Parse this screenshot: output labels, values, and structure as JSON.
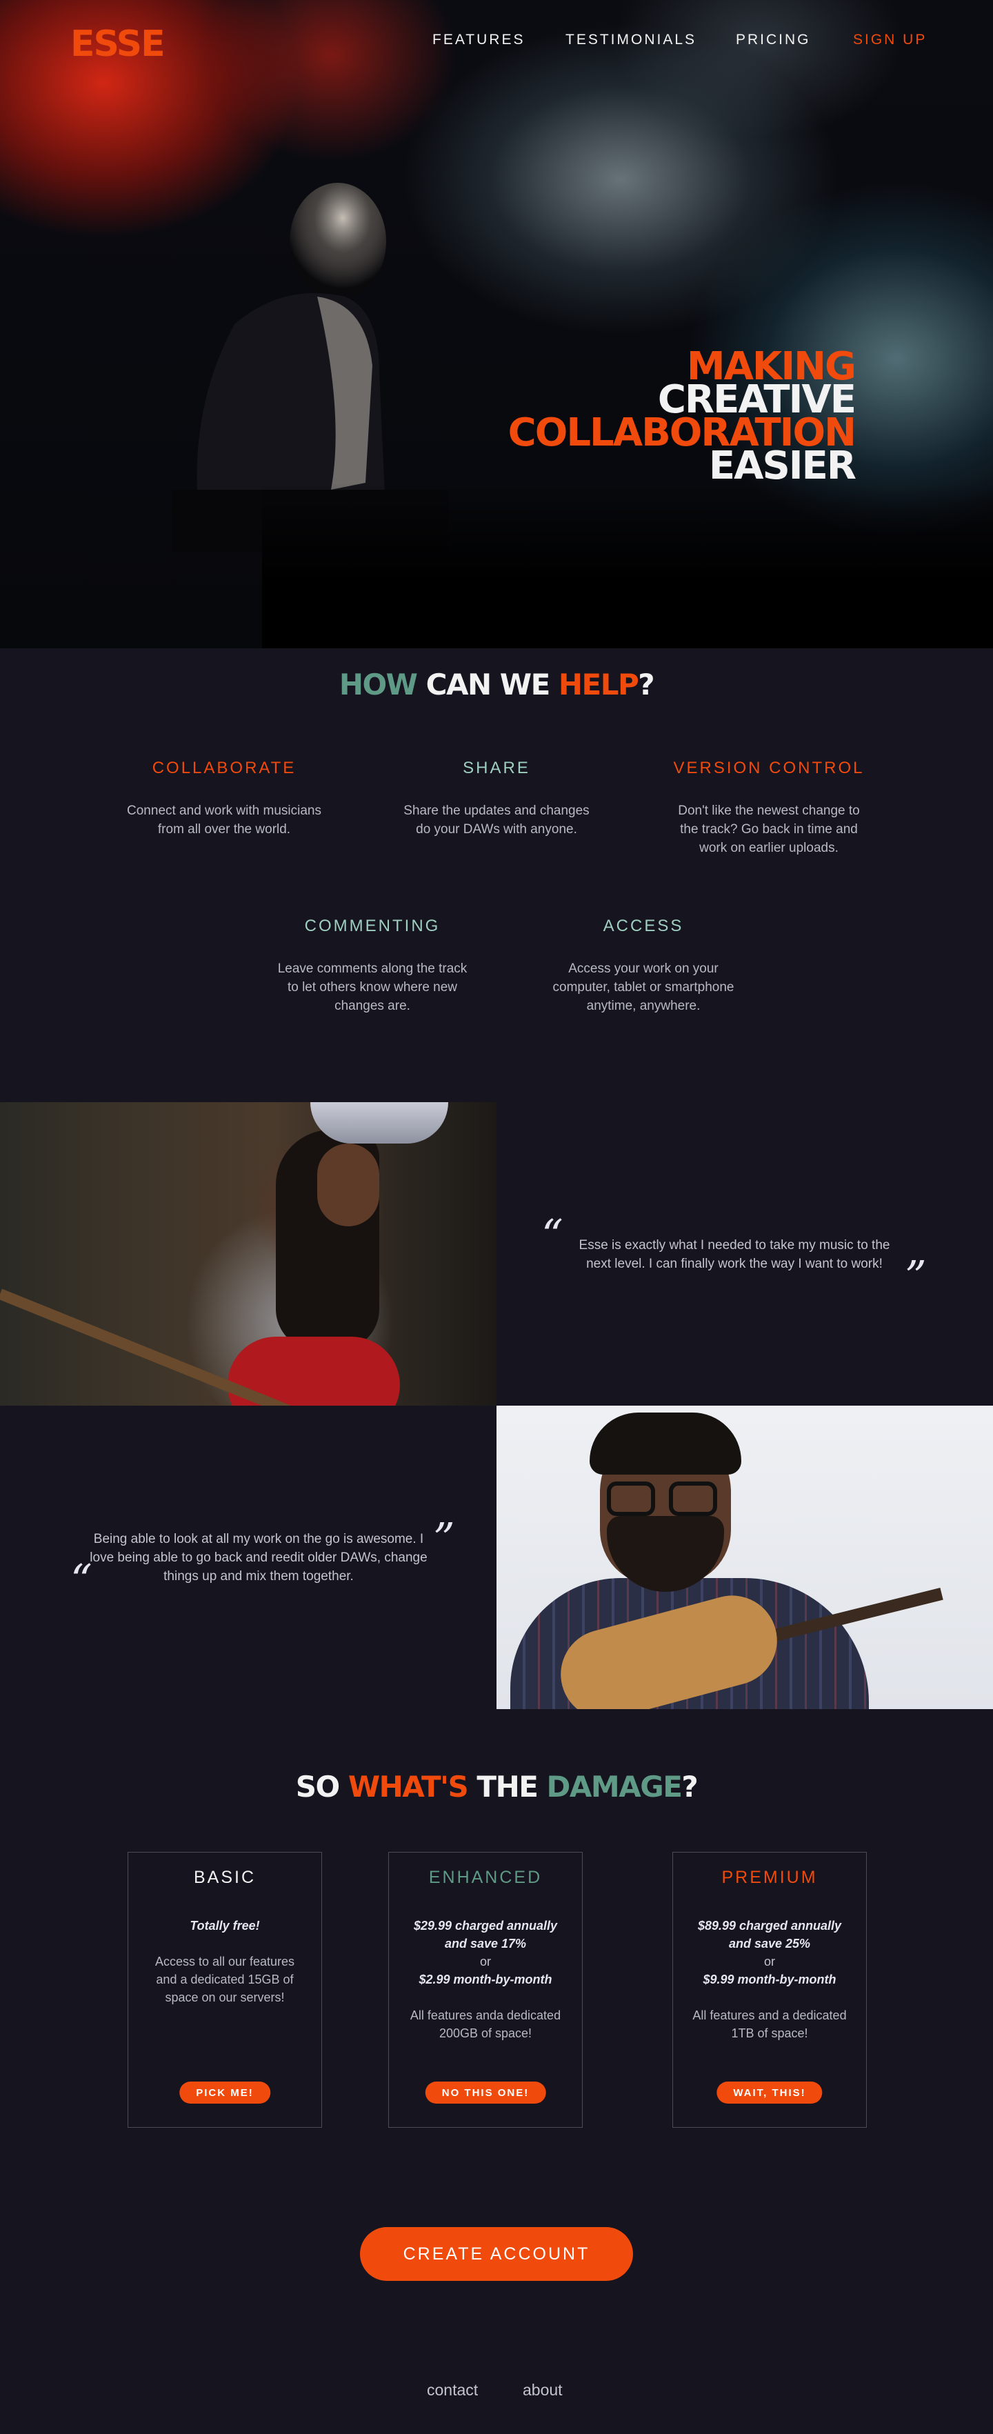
{
  "brand": {
    "logo": "ESSE"
  },
  "nav": {
    "features": "FEATURES",
    "testimonials": "TESTIMONIALS",
    "pricing": "PRICING",
    "signup": "SIGN UP"
  },
  "hero": {
    "line1": "MAKING",
    "line2": "CREATIVE",
    "line3": "COLLABORATION",
    "line4": "EASIER"
  },
  "help": {
    "heading": {
      "w1": "HOW",
      "w2": "CAN WE",
      "w3": "HELP",
      "w4": "?"
    },
    "features": [
      {
        "title": "COLLABORATE",
        "text": "Connect and work with musicians from all over the world."
      },
      {
        "title": "SHARE",
        "text": "Share the updates and changes do your DAWs with anyone."
      },
      {
        "title": "VERSION CONTROL",
        "text": "Don't like the newest change to the track? Go back in time and work on earlier uploads."
      },
      {
        "title": "COMMENTING",
        "text": "Leave comments along the track to let others know where new changes are."
      },
      {
        "title": "ACCESS",
        "text": "Access your work on your computer, tablet or smartphone anytime, anywhere."
      }
    ]
  },
  "testimonials": [
    {
      "quote": "Esse is exactly what I needed to take my music to the next level. I can finally work the way I want to work!"
    },
    {
      "quote": "Being able to look at all my work on the go is awesome. I love being able to go back and reedit older DAWs, change things up and mix them together."
    }
  ],
  "quote_marks": {
    "open": "“",
    "close": "”"
  },
  "pricing": {
    "heading": {
      "w1": "SO",
      "w2": "WHAT'S",
      "w3": "THE",
      "w4": "DAMAGE",
      "w5": "?"
    },
    "plans": [
      {
        "name": "BASIC",
        "price1": "Totally free!",
        "desc": "Access to all our features and a dedicated 15GB of space on our servers!",
        "button": "PICK ME!"
      },
      {
        "name": "ENHANCED",
        "price1": "$29.99 charged annually and save 17%",
        "or": "or",
        "price2": "$2.99 month-by-month",
        "desc": "All features anda dedicated 200GB of space!",
        "button": "NO THIS ONE!"
      },
      {
        "name": "PREMIUM",
        "price1": "$89.99 charged annually and save 25%",
        "or": "or",
        "price2": "$9.99 month-by-month",
        "desc": "All features and a dedicated 1TB of space!",
        "button": "WAIT, THIS!"
      }
    ]
  },
  "cta": {
    "label": "CREATE ACCOUNT"
  },
  "footer": {
    "contact": "contact",
    "about": "about"
  },
  "colors": {
    "accent": "#f04a0c",
    "green": "#5f9a86",
    "background": "#15141f"
  }
}
